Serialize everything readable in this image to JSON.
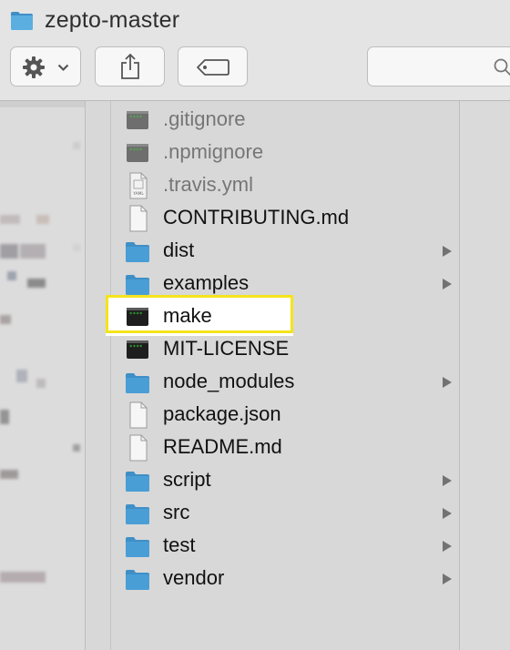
{
  "window": {
    "title": "zepto-master"
  },
  "toolbar": {
    "action_icon": "gear-icon",
    "share_icon": "share-icon",
    "tag_icon": "tag-icon",
    "search_icon": "search-icon"
  },
  "files": [
    {
      "name": ".gitignore",
      "kind": "exec-doc",
      "dim": true,
      "folder": false
    },
    {
      "name": ".npmignore",
      "kind": "exec-doc",
      "dim": true,
      "folder": false
    },
    {
      "name": ".travis.yml",
      "kind": "yaml-doc",
      "dim": true,
      "folder": false
    },
    {
      "name": "CONTRIBUTING.md",
      "kind": "plain-doc",
      "dim": false,
      "folder": false
    },
    {
      "name": "dist",
      "kind": "folder",
      "dim": false,
      "folder": true
    },
    {
      "name": "examples",
      "kind": "folder",
      "dim": false,
      "folder": true
    },
    {
      "name": "make",
      "kind": "terminal",
      "dim": false,
      "folder": false,
      "highlighted": true
    },
    {
      "name": "MIT-LICENSE",
      "kind": "terminal",
      "dim": false,
      "folder": false
    },
    {
      "name": "node_modules",
      "kind": "folder",
      "dim": false,
      "folder": true
    },
    {
      "name": "package.json",
      "kind": "plain-doc",
      "dim": false,
      "folder": false
    },
    {
      "name": "README.md",
      "kind": "plain-doc",
      "dim": false,
      "folder": false
    },
    {
      "name": "script",
      "kind": "folder",
      "dim": false,
      "folder": true
    },
    {
      "name": "src",
      "kind": "folder",
      "dim": false,
      "folder": true
    },
    {
      "name": "test",
      "kind": "folder",
      "dim": false,
      "folder": true
    },
    {
      "name": "vendor",
      "kind": "folder",
      "dim": false,
      "folder": true
    }
  ],
  "yaml_badge": "YAML",
  "colors": {
    "folder": "#4a9ed6",
    "highlight_border": "#f5e41c",
    "selection": "#ffffff"
  }
}
